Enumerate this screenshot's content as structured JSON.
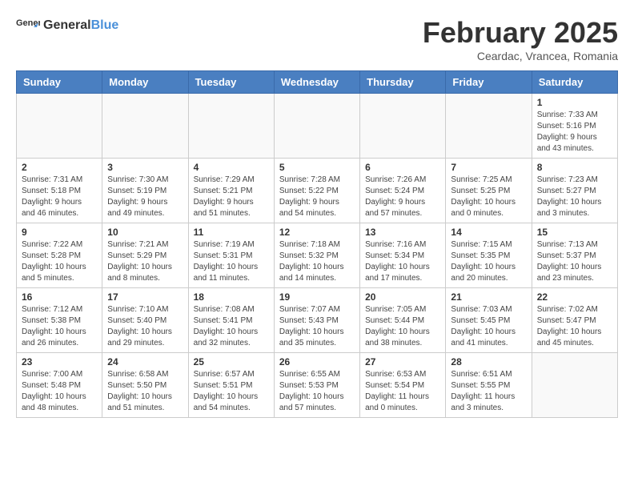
{
  "logo": {
    "general": "General",
    "blue": "Blue"
  },
  "header": {
    "month": "February 2025",
    "location": "Ceardac, Vrancea, Romania"
  },
  "weekdays": [
    "Sunday",
    "Monday",
    "Tuesday",
    "Wednesday",
    "Thursday",
    "Friday",
    "Saturday"
  ],
  "weeks": [
    [
      {
        "day": "",
        "info": ""
      },
      {
        "day": "",
        "info": ""
      },
      {
        "day": "",
        "info": ""
      },
      {
        "day": "",
        "info": ""
      },
      {
        "day": "",
        "info": ""
      },
      {
        "day": "",
        "info": ""
      },
      {
        "day": "1",
        "info": "Sunrise: 7:33 AM\nSunset: 5:16 PM\nDaylight: 9 hours and 43 minutes."
      }
    ],
    [
      {
        "day": "2",
        "info": "Sunrise: 7:31 AM\nSunset: 5:18 PM\nDaylight: 9 hours and 46 minutes."
      },
      {
        "day": "3",
        "info": "Sunrise: 7:30 AM\nSunset: 5:19 PM\nDaylight: 9 hours and 49 minutes."
      },
      {
        "day": "4",
        "info": "Sunrise: 7:29 AM\nSunset: 5:21 PM\nDaylight: 9 hours and 51 minutes."
      },
      {
        "day": "5",
        "info": "Sunrise: 7:28 AM\nSunset: 5:22 PM\nDaylight: 9 hours and 54 minutes."
      },
      {
        "day": "6",
        "info": "Sunrise: 7:26 AM\nSunset: 5:24 PM\nDaylight: 9 hours and 57 minutes."
      },
      {
        "day": "7",
        "info": "Sunrise: 7:25 AM\nSunset: 5:25 PM\nDaylight: 10 hours and 0 minutes."
      },
      {
        "day": "8",
        "info": "Sunrise: 7:23 AM\nSunset: 5:27 PM\nDaylight: 10 hours and 3 minutes."
      }
    ],
    [
      {
        "day": "9",
        "info": "Sunrise: 7:22 AM\nSunset: 5:28 PM\nDaylight: 10 hours and 5 minutes."
      },
      {
        "day": "10",
        "info": "Sunrise: 7:21 AM\nSunset: 5:29 PM\nDaylight: 10 hours and 8 minutes."
      },
      {
        "day": "11",
        "info": "Sunrise: 7:19 AM\nSunset: 5:31 PM\nDaylight: 10 hours and 11 minutes."
      },
      {
        "day": "12",
        "info": "Sunrise: 7:18 AM\nSunset: 5:32 PM\nDaylight: 10 hours and 14 minutes."
      },
      {
        "day": "13",
        "info": "Sunrise: 7:16 AM\nSunset: 5:34 PM\nDaylight: 10 hours and 17 minutes."
      },
      {
        "day": "14",
        "info": "Sunrise: 7:15 AM\nSunset: 5:35 PM\nDaylight: 10 hours and 20 minutes."
      },
      {
        "day": "15",
        "info": "Sunrise: 7:13 AM\nSunset: 5:37 PM\nDaylight: 10 hours and 23 minutes."
      }
    ],
    [
      {
        "day": "16",
        "info": "Sunrise: 7:12 AM\nSunset: 5:38 PM\nDaylight: 10 hours and 26 minutes."
      },
      {
        "day": "17",
        "info": "Sunrise: 7:10 AM\nSunset: 5:40 PM\nDaylight: 10 hours and 29 minutes."
      },
      {
        "day": "18",
        "info": "Sunrise: 7:08 AM\nSunset: 5:41 PM\nDaylight: 10 hours and 32 minutes."
      },
      {
        "day": "19",
        "info": "Sunrise: 7:07 AM\nSunset: 5:43 PM\nDaylight: 10 hours and 35 minutes."
      },
      {
        "day": "20",
        "info": "Sunrise: 7:05 AM\nSunset: 5:44 PM\nDaylight: 10 hours and 38 minutes."
      },
      {
        "day": "21",
        "info": "Sunrise: 7:03 AM\nSunset: 5:45 PM\nDaylight: 10 hours and 41 minutes."
      },
      {
        "day": "22",
        "info": "Sunrise: 7:02 AM\nSunset: 5:47 PM\nDaylight: 10 hours and 45 minutes."
      }
    ],
    [
      {
        "day": "23",
        "info": "Sunrise: 7:00 AM\nSunset: 5:48 PM\nDaylight: 10 hours and 48 minutes."
      },
      {
        "day": "24",
        "info": "Sunrise: 6:58 AM\nSunset: 5:50 PM\nDaylight: 10 hours and 51 minutes."
      },
      {
        "day": "25",
        "info": "Sunrise: 6:57 AM\nSunset: 5:51 PM\nDaylight: 10 hours and 54 minutes."
      },
      {
        "day": "26",
        "info": "Sunrise: 6:55 AM\nSunset: 5:53 PM\nDaylight: 10 hours and 57 minutes."
      },
      {
        "day": "27",
        "info": "Sunrise: 6:53 AM\nSunset: 5:54 PM\nDaylight: 11 hours and 0 minutes."
      },
      {
        "day": "28",
        "info": "Sunrise: 6:51 AM\nSunset: 5:55 PM\nDaylight: 11 hours and 3 minutes."
      },
      {
        "day": "",
        "info": ""
      }
    ]
  ]
}
